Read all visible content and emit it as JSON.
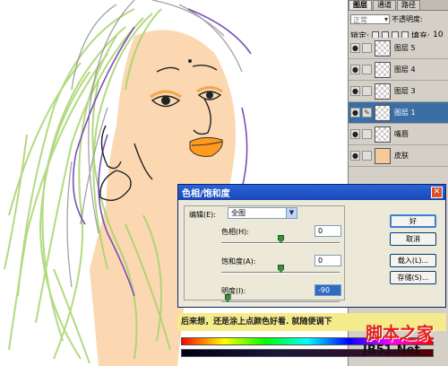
{
  "panel": {
    "tabs": [
      "图层",
      "通道",
      "路径"
    ],
    "blend_mode": "正常",
    "opacity_label": "不透明度:",
    "lock_label": "锁定:",
    "fill_label": "填充:",
    "fill_value": "10",
    "layers": [
      {
        "name": "图层 5",
        "selected": false
      },
      {
        "name": "图层 4",
        "selected": false
      },
      {
        "name": "图层 3",
        "selected": false
      },
      {
        "name": "图层 1",
        "selected": true
      },
      {
        "name": "嘴唇",
        "selected": false
      },
      {
        "name": "皮肤",
        "selected": false
      }
    ]
  },
  "dialog": {
    "title": "色相/饱和度",
    "edit_label": "编辑(E):",
    "edit_value": "全图",
    "hue_label": "色相(H):",
    "hue_value": "0",
    "hue_position": 0.5,
    "saturation_label": "饱和度(A):",
    "saturation_value": "0",
    "saturation_position": 0.5,
    "lightness_label": "明度(I):",
    "lightness_value": "-90",
    "lightness_position": 0.05,
    "ok_label": "好",
    "cancel_label": "取消",
    "load_label": "载入(L)...",
    "save_label": "存储(S)..."
  },
  "caption": "后来想，还是涂上点颜色好看. 就随便调下",
  "watermark": "脚本之家",
  "watermark_url": "JB51.Net"
}
